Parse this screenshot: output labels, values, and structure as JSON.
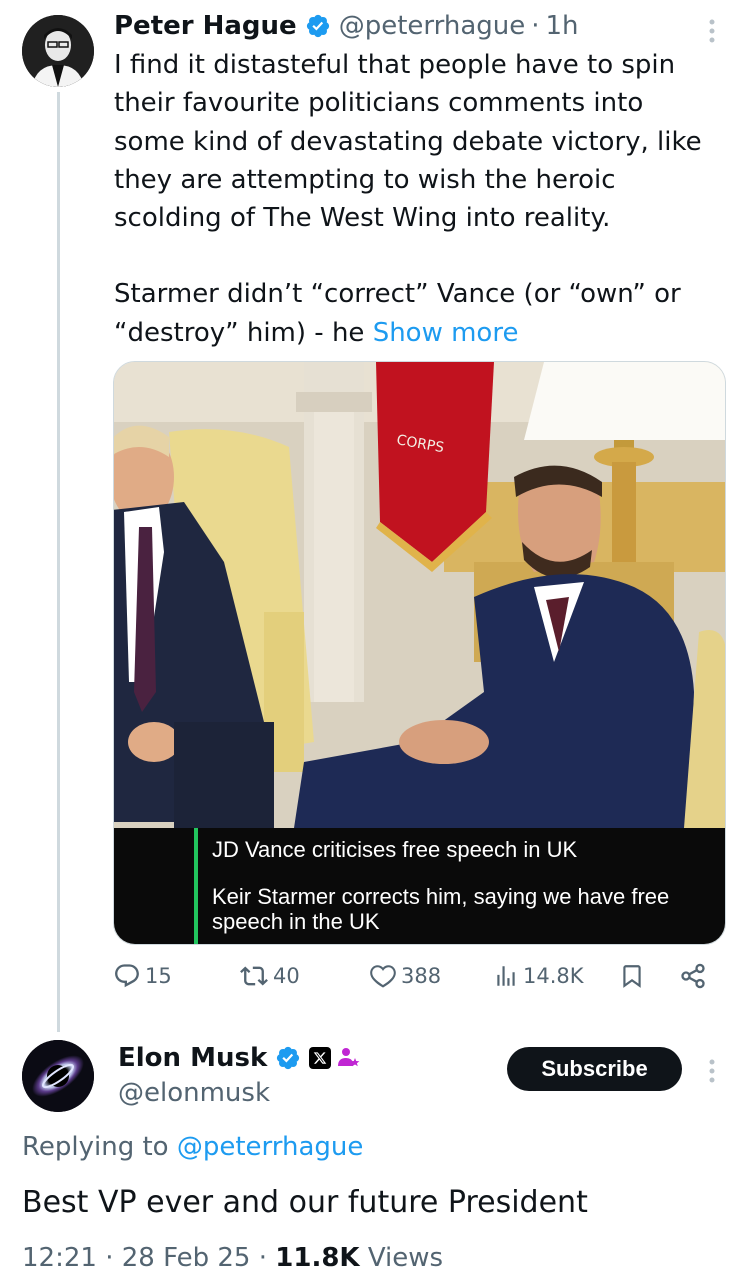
{
  "tweet1": {
    "author_name": "Peter Hague",
    "handle": "@peterrhague",
    "separator": "·",
    "time": "1h",
    "text_lines": [
      "I find it distasteful that people have to spin",
      "their favourite politicians comments into",
      "some kind of devastating debate victory, like",
      "they are attempting to wish the heroic",
      "scolding of The West Wing into reality."
    ],
    "text2_line1": "Starmer didn’t “correct” Vance (or “own” or",
    "text2_line2_prefix": "“destroy” him) - he ",
    "show_more": "Show more",
    "media": {
      "caption_line1": "JD Vance criticises free speech in UK",
      "caption_line2": "Keir Starmer corrects him, saying we have free speech in the UK",
      "flag_text": "CORPS"
    },
    "actions": {
      "replies": "15",
      "reposts": "40",
      "likes": "388",
      "views": "14.8K"
    }
  },
  "tweet2": {
    "author_name": "Elon Musk",
    "handle": "@elonmusk",
    "subscribe_label": "Subscribe",
    "replying_prefix": "Replying to ",
    "replying_handle": "@peterrhague",
    "text": "Best VP ever and our future President",
    "time": "12:21",
    "date": "28 Feb 25",
    "views_count": "11.8K",
    "views_label": "Views",
    "separator": "·"
  },
  "colors": {
    "accent": "#1d9bf0",
    "text": "#0f1419",
    "muted": "#536471",
    "caption_bar": "#22c55e"
  },
  "icons": [
    "verified-badge-icon",
    "more-vertical-icon",
    "reply-icon",
    "repost-icon",
    "like-icon",
    "views-icon",
    "bookmark-icon",
    "share-icon",
    "x-logo-icon",
    "affiliate-icon"
  ]
}
